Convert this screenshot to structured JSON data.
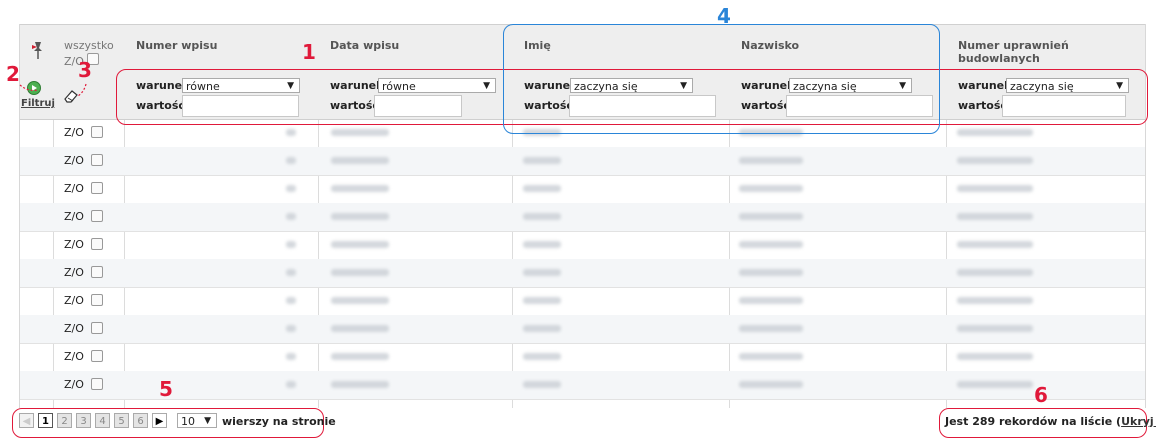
{
  "header": {
    "all_label": "wszystko",
    "zo_label": "Z/O",
    "columns": [
      "Numer wpisu",
      "Data wpisu",
      "Imię",
      "Nazwisko",
      "Numer uprawnień budowlanych"
    ]
  },
  "filter": {
    "apply_label": "Filtruj",
    "condition_label": "warunek",
    "value_label": "wartość",
    "conditions": [
      "równe",
      "równe",
      "zaczyna się",
      "zaczyna się",
      "zaczyna się"
    ]
  },
  "rows": {
    "zo_label": "Z/O",
    "count": 10
  },
  "pager": {
    "pages": [
      "1",
      "2",
      "3",
      "4",
      "5",
      "6"
    ],
    "current": "1",
    "per_page": "10",
    "per_page_label": "wierszy na stronie"
  },
  "footer": {
    "records_text": "Jest 289 rekordów na liście (",
    "hide_link": "Ukryj je",
    "close_paren": ")"
  },
  "annotations": {
    "n1": "1",
    "n2": "2",
    "n3": "3",
    "n4": "4",
    "n5": "5",
    "n6": "6"
  },
  "colors": {
    "annotation_red": "#e0193a",
    "annotation_blue": "#2a85d8"
  }
}
